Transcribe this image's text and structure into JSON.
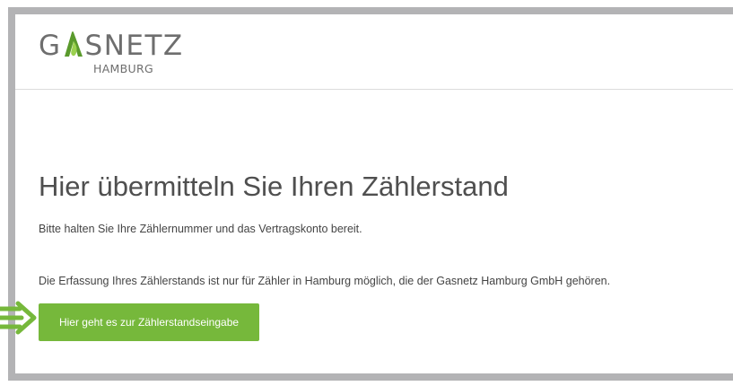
{
  "logo": {
    "word_before": "G",
    "word_after": "SNETZ",
    "sub": "HAMBURG",
    "flame_icon": "flame-icon"
  },
  "main": {
    "headline": "Hier übermitteln Sie Ihren Zählerstand",
    "para1": "Bitte halten Sie Ihre Zählernummer und das Vertragskonto bereit.",
    "para2": "Die Erfassung Ihres Zählerstands ist nur für Zähler in Hamburg möglich, die der Gasnetz Hamburg GmbH gehören.",
    "cta_label": "Hier geht es zur Zählerstandseingabe"
  },
  "annotation": {
    "arrow_icon": "arrow-right-icon",
    "arrow_color": "#76b83b"
  },
  "colors": {
    "accent": "#76b83b",
    "frame": "#b3b3b5",
    "flame_dark": "#5a9a2c",
    "flame_light": "#9bd14f"
  }
}
